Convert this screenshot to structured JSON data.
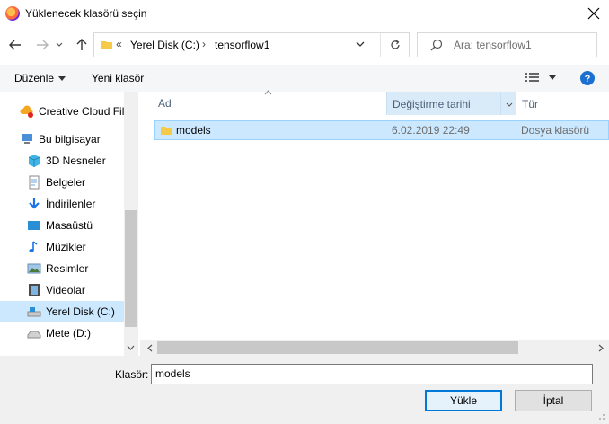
{
  "window": {
    "title": "Yüklenecek klasörü seçin"
  },
  "nav": {
    "breadcrumb_prefix": "«",
    "breadcrumbs": [
      "Yerel Disk (C:)",
      "tensorflow1"
    ],
    "search_placeholder": "Ara: tensorflow1"
  },
  "toolbar": {
    "organize": "Düzenle",
    "new_folder": "Yeni klasör"
  },
  "sidebar": {
    "items": [
      {
        "label": "Creative Cloud Fil",
        "icon": "creative-cloud-icon"
      },
      {
        "label": "Bu bilgisayar",
        "icon": "computer-icon"
      },
      {
        "label": "3D Nesneler",
        "icon": "3d-objects-icon"
      },
      {
        "label": "Belgeler",
        "icon": "documents-icon"
      },
      {
        "label": "İndirilenler",
        "icon": "downloads-icon"
      },
      {
        "label": "Masaüstü",
        "icon": "desktop-icon"
      },
      {
        "label": "Müzikler",
        "icon": "music-icon"
      },
      {
        "label": "Resimler",
        "icon": "pictures-icon"
      },
      {
        "label": "Videolar",
        "icon": "videos-icon"
      },
      {
        "label": "Yerel Disk (C:)",
        "icon": "local-disk-icon"
      },
      {
        "label": "Mete (D:)",
        "icon": "drive-icon"
      }
    ]
  },
  "file_list": {
    "columns": [
      "Ad",
      "Değiştirme tarihi",
      "Tür"
    ],
    "rows": [
      {
        "name": "models",
        "modified": "6.02.2019 22:49",
        "type": "Dosya klasörü"
      }
    ]
  },
  "footer": {
    "folder_label": "Klasör:",
    "folder_value": "models",
    "upload_label": "Yükle",
    "cancel_label": "İptal"
  },
  "colors": {
    "selection": "#cce8ff",
    "accent": "#0078d7",
    "help": "#1a6fd1"
  }
}
